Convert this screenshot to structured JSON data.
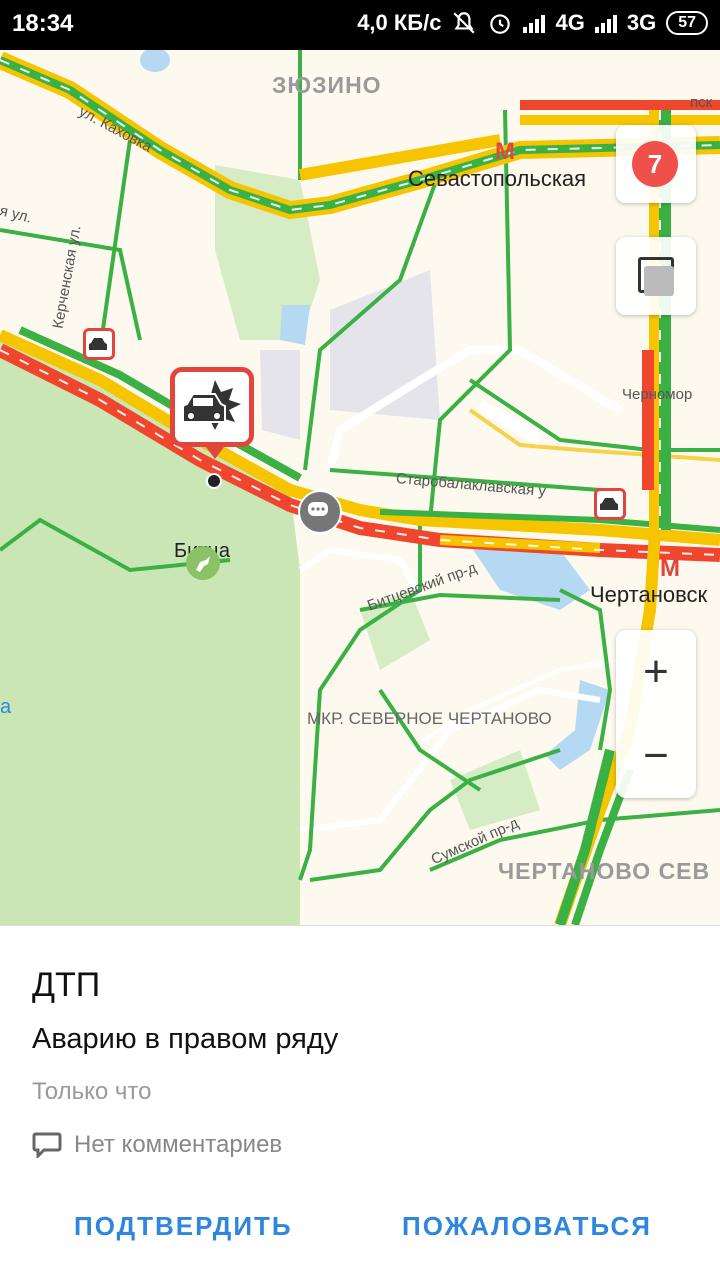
{
  "status_bar": {
    "time": "18:34",
    "speed": "4,0 КБ/с",
    "net1": "4G",
    "net2": "3G",
    "battery": "57"
  },
  "map": {
    "labels": {
      "district_zyuzino": "ЗЮЗИНО",
      "metro_sevastopolskaya": "Севастопольская",
      "street_kakhovka": "ул. Каховка",
      "street_kerchenskaya": "Керченская ул.",
      "street_left_ul": "я ул.",
      "street_starobalaklavskaya": "Старобалаклавская у",
      "street_chernomorsky": "Черномор",
      "street_bitsevsky": "Битцевский пр-д",
      "metro_chertanovskaya": "Чертановск",
      "park_bitsa": "Битца",
      "district_north_chertanovo": "МКР. СЕВЕРНОЕ ЧЕРТАНОВО",
      "street_sumskoy": "Сумской пр-д",
      "district_chertanovo_sev": "ЧЕРТАНОВО СЕВ",
      "street_right_top": "пск",
      "edge_letter": "а"
    },
    "traffic_level": "7",
    "zoom_in_symbol": "+",
    "zoom_out_symbol": "−",
    "colors": {
      "jam_red": "#f0462d",
      "slow_yellow": "#f6c500",
      "free_green": "#3bb044",
      "park_green": "#c9e6b4",
      "water_blue": "#b5d9f3",
      "road_white": "#ffffff",
      "background": "#fdf9ee"
    }
  },
  "card": {
    "title": "ДТП",
    "description": "Аварию в правом ряду",
    "time": "Только что",
    "comments": "Нет комментариев",
    "confirm_label": "ПОДТВЕРДИТЬ",
    "report_label": "ПОЖАЛОВАТЬСЯ"
  }
}
